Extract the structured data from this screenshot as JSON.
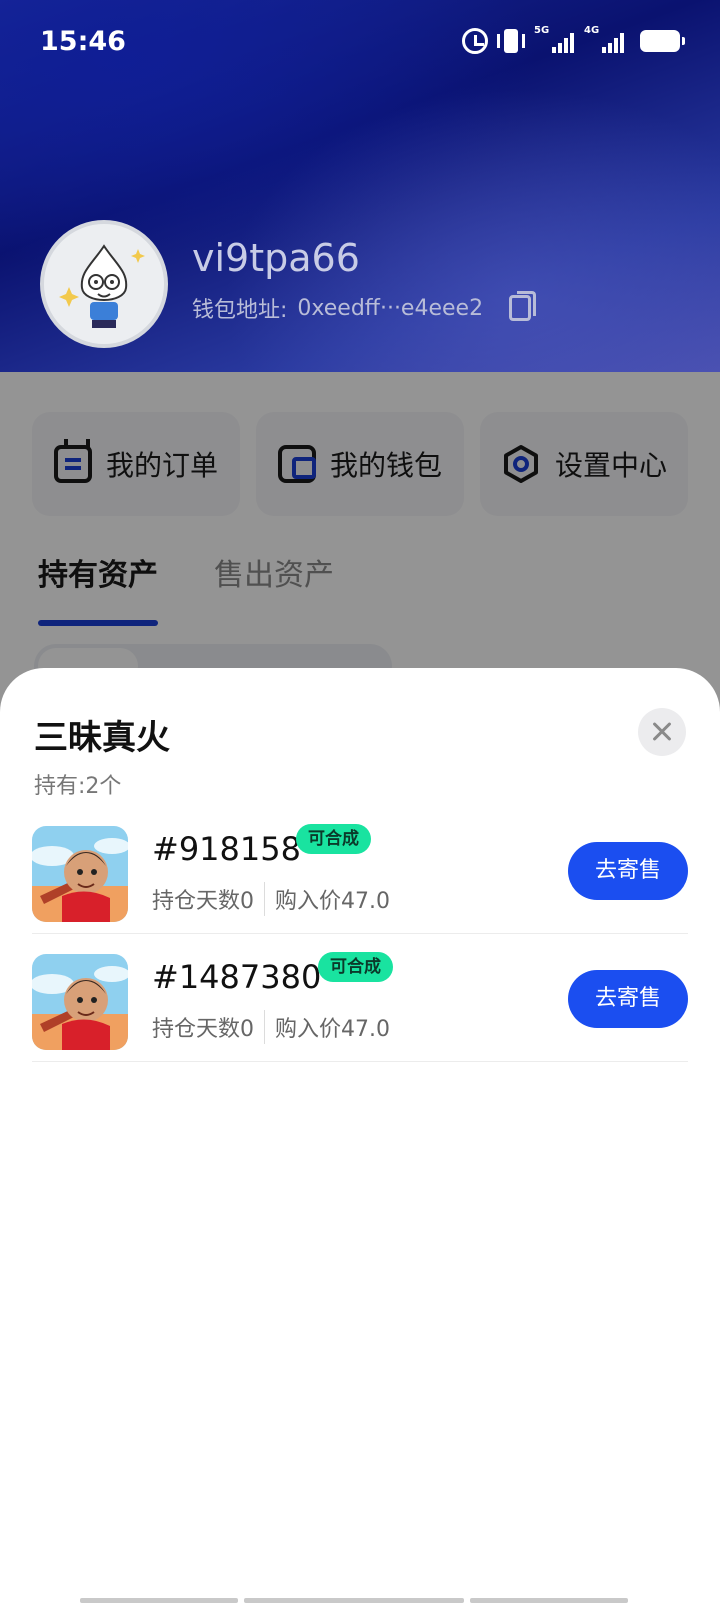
{
  "status_bar": {
    "time": "15:46",
    "network_5g": "5G",
    "network_4g": "4G"
  },
  "profile": {
    "username": "vi9tpa66",
    "wallet_label": "钱包地址:",
    "wallet_address": "0xeedff···e4eee2"
  },
  "quick_actions": {
    "orders": "我的订单",
    "wallet": "我的钱包",
    "settings": "设置中心"
  },
  "tabs": {
    "held": "持有资产",
    "sold": "售出资产"
  },
  "sheet": {
    "title": "三昧真火",
    "holding_label": "持有:",
    "holding_count": "2个",
    "items": [
      {
        "id": "#918158",
        "badge": "可合成",
        "days_held": "持仓天数0",
        "buy_price": "购入价47.0",
        "action": "去寄售"
      },
      {
        "id": "#1487380",
        "badge": "可合成",
        "days_held": "持仓天数0",
        "buy_price": "购入价47.0",
        "action": "去寄售"
      }
    ]
  },
  "colors": {
    "accent": "#1b4ef0",
    "badge": "#19e3a0",
    "header_dark": "#0a1270"
  },
  "icons": {
    "close": "close-icon",
    "copy": "copy-icon",
    "orders": "order-icon",
    "wallet": "wallet-icon",
    "settings": "settings-icon"
  }
}
